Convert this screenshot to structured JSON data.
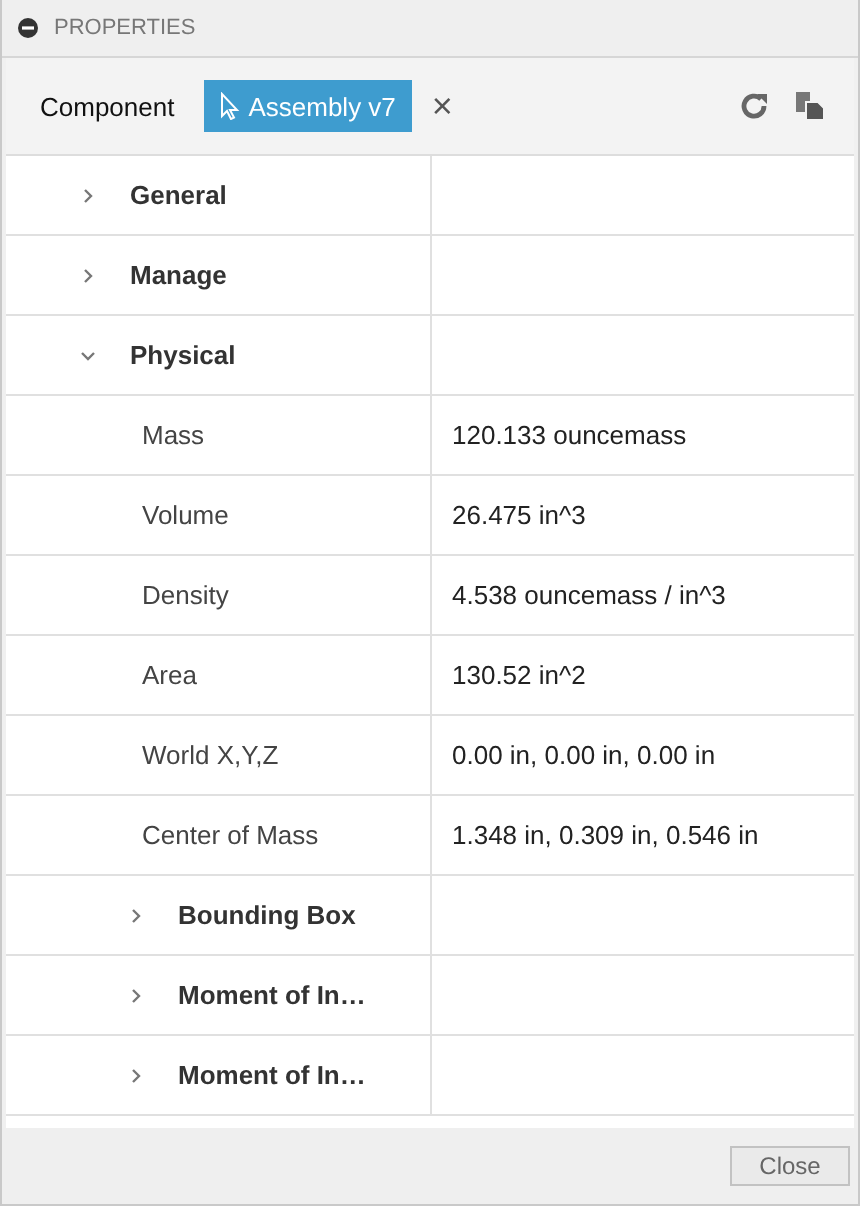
{
  "panel": {
    "title": "PROPERTIES"
  },
  "toolbar": {
    "label": "Component",
    "selection": "Assembly v7",
    "clear": "×"
  },
  "tree": [
    {
      "kind": "group",
      "label": "General",
      "expanded": false
    },
    {
      "kind": "group",
      "label": "Manage",
      "expanded": false
    },
    {
      "kind": "group",
      "label": "Physical",
      "expanded": true,
      "children": [
        {
          "kind": "property",
          "label": "Mass",
          "value": "120.133 ouncemass"
        },
        {
          "kind": "property",
          "label": "Volume",
          "value": "26.475 in^3"
        },
        {
          "kind": "property",
          "label": "Density",
          "value": "4.538 ouncemass / in^3"
        },
        {
          "kind": "property",
          "label": "Area",
          "value": "130.52 in^2"
        },
        {
          "kind": "property",
          "label": "World X,Y,Z",
          "value": "0.00 in, 0.00 in, 0.00 in"
        },
        {
          "kind": "property",
          "label": "Center of Mass",
          "value": "1.348 in, 0.309 in, 0.546 in"
        },
        {
          "kind": "group",
          "label": "Bounding Box",
          "expanded": false
        },
        {
          "kind": "group",
          "label": "Moment of In…",
          "expanded": false
        },
        {
          "kind": "group",
          "label": "Moment of In…",
          "expanded": false
        }
      ]
    }
  ],
  "footer": {
    "button": "Close"
  }
}
